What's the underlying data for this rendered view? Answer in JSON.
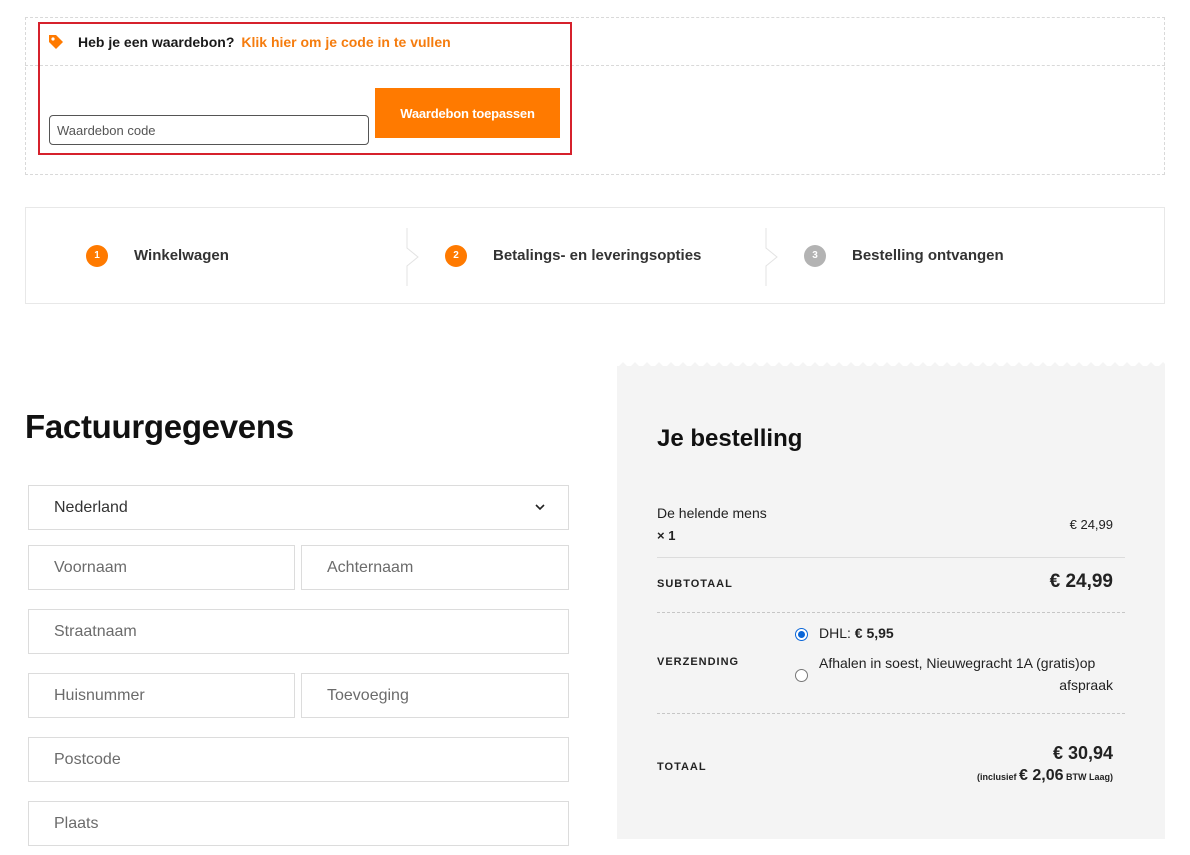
{
  "coupon": {
    "question": "Heb je een waardebon?",
    "link": "Klik hier om je code in te vullen",
    "input_placeholder": "Waardebon code",
    "apply_button": "Waardebon toepassen"
  },
  "steps": [
    {
      "number": "1",
      "label": "Winkelwagen",
      "active": true
    },
    {
      "number": "2",
      "label": "Betalings- en leveringsopties",
      "active": true
    },
    {
      "number": "3",
      "label": "Bestelling ontvangen",
      "active": false
    }
  ],
  "billing": {
    "title": "Factuurgegevens",
    "country": "Nederland",
    "fields": {
      "first_name": "Voornaam",
      "last_name": "Achternaam",
      "street": "Straatnaam",
      "house_number": "Huisnummer",
      "addition": "Toevoeging",
      "postcode": "Postcode",
      "city": "Plaats"
    }
  },
  "order": {
    "title": "Je bestelling",
    "item_name": "De helende mens",
    "item_qty": "× 1",
    "item_price": "€ 24,99",
    "subtotal_label": "SUBTOTAAL",
    "subtotal_value": "€ 24,99",
    "shipping_label": "VERZENDING",
    "shipping_options": [
      {
        "label": "DHL:",
        "price": "€ 5,95",
        "selected": true
      },
      {
        "label_line1": "Afhalen in soest, Nieuwegracht 1A (gratis)op",
        "label_line2": "afspraak",
        "selected": false
      }
    ],
    "total_label": "TOTAAL",
    "total_value": "€ 30,94",
    "tax_prefix": "(inclusief",
    "tax_value": "€ 2,06",
    "tax_suffix": "BTW Laag)"
  },
  "colors": {
    "accent": "#ff7a00",
    "highlight_border": "#d6212c",
    "radio_selected": "#0a66d8",
    "step_inactive": "#b3b3b3"
  }
}
